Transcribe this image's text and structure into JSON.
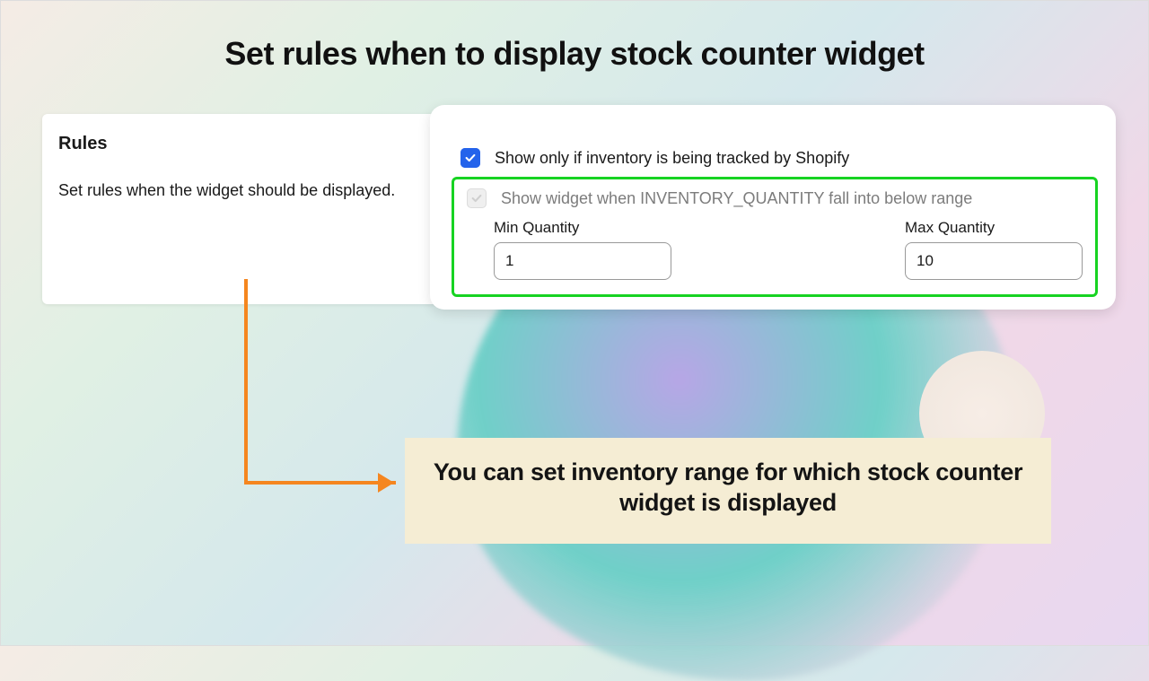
{
  "page": {
    "title": "Set rules when to display stock counter widget"
  },
  "rules": {
    "heading": "Rules",
    "description": "Set rules when the widget should be displayed."
  },
  "checkbox1": {
    "label": "Show only if inventory is being tracked by Shopify",
    "checked": true
  },
  "checkbox2": {
    "label": "Show widget when INVENTORY_QUANTITY fall into below range",
    "checked": false
  },
  "quantity": {
    "min_label": "Min Quantity",
    "min_value": "1",
    "max_label": "Max Quantity",
    "max_value": "10"
  },
  "callout": {
    "text": "You can set inventory range for which stock counter widget is displayed"
  },
  "colors": {
    "highlight_border": "#17d322",
    "accent": "#2463eb",
    "arrow": "#f5861f"
  }
}
